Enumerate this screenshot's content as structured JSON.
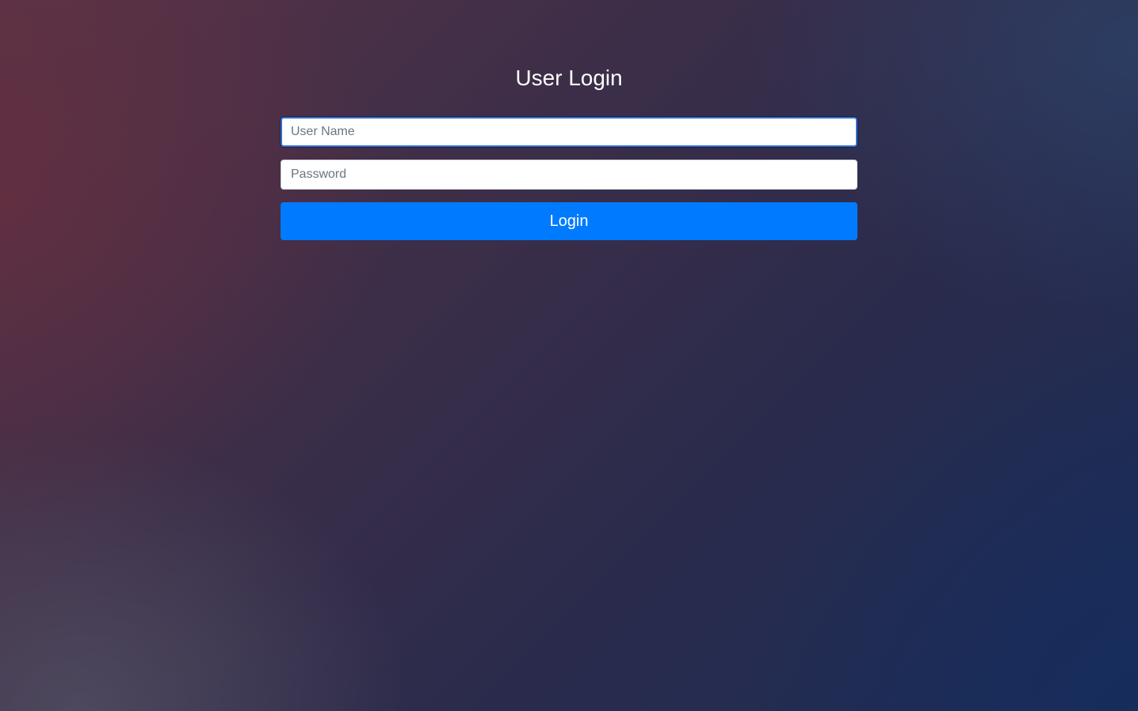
{
  "page": {
    "title": "User Login"
  },
  "form": {
    "username": {
      "value": "",
      "placeholder": "User Name"
    },
    "password": {
      "value": "",
      "placeholder": "Password"
    },
    "submit_label": "Login"
  },
  "colors": {
    "button_bg": "#007bff",
    "button_text": "#ffffff",
    "title_text": "#ffffff",
    "focus_border": "#2f6fd8"
  }
}
